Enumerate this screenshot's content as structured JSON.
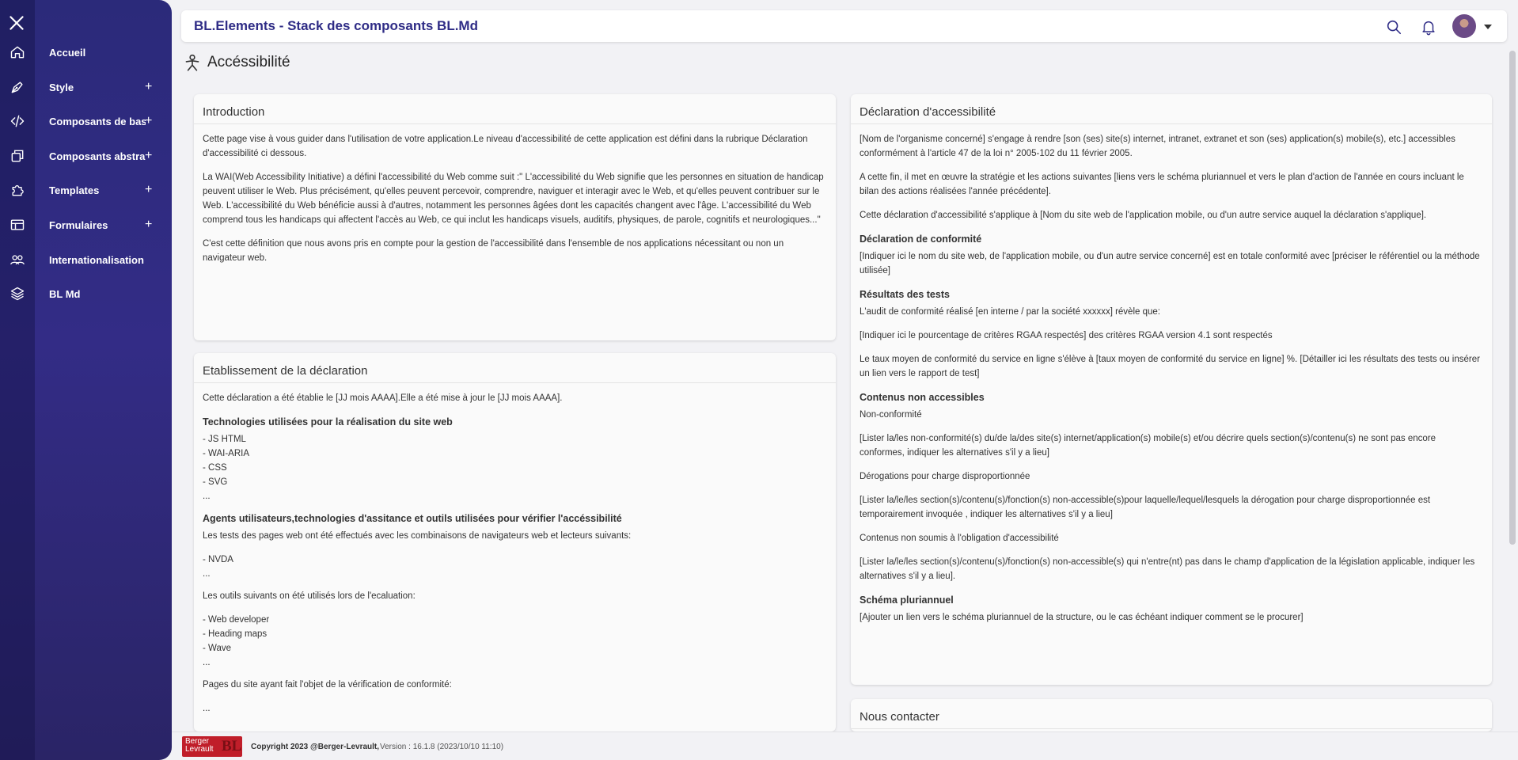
{
  "header": {
    "title": "BL.Elements - Stack des composants BL.Md",
    "icons": [
      "search-icon",
      "bell-icon",
      "avatar",
      "caret-down-icon"
    ]
  },
  "sidebar": {
    "items": [
      {
        "label": "Accueil",
        "icon": "home-icon",
        "expandable": false
      },
      {
        "label": "Style",
        "icon": "pen-icon",
        "expandable": true
      },
      {
        "label": "Composants de base",
        "icon": "code-icon",
        "expandable": true
      },
      {
        "label": "Composants abstraits",
        "icon": "copy-icon",
        "expandable": true
      },
      {
        "label": "Templates",
        "icon": "puzzle-icon",
        "expandable": true
      },
      {
        "label": "Formulaires",
        "icon": "form-icon",
        "expandable": true
      },
      {
        "label": "Internationalisation",
        "icon": "people-icon",
        "expandable": false
      },
      {
        "label": "BL Md",
        "icon": "layers-icon",
        "expandable": false
      }
    ],
    "plus": "+"
  },
  "page": {
    "title": "Accéssibilité"
  },
  "intro": {
    "title": "Introduction",
    "p1": "Cette page vise à vous guider dans l'utilisation de votre application.Le niveau d'accessibilité de cette application est défini dans la rubrique Déclaration d'accessibilité ci dessous.",
    "p2": "La WAI(Web Accessibility Initiative) a défini l'accessibilité du Web comme suit :\" L'accessibilité du Web signifie que les personnes en situation de handicap peuvent utiliser le Web. Plus précisément, qu'elles peuvent percevoir, comprendre, naviguer et interagir avec le Web, et qu'elles peuvent contribuer sur le Web. L'accessibilité du Web bénéficie aussi à d'autres, notamment les personnes âgées dont les capacités changent avec l'âge. L'accessibilité du Web comprend tous les handicaps qui affectent l'accès au Web, ce qui inclut les handicaps visuels, auditifs, physiques, de parole, cognitifs et neurologiques...\"",
    "p3": "C'est cette définition que nous avons pris en compte pour la gestion de l'accessibilité dans l'ensemble de nos applications nécessitant ou non un navigateur web."
  },
  "etab": {
    "title": "Etablissement de la déclaration",
    "p1": "Cette déclaration a été établie le [JJ mois AAAA].Elle a été mise à jour le [JJ mois AAAA].",
    "h1": "Technologies utilisées pour la réalisation du site web",
    "tech": [
      "- JS HTML",
      "- WAI-ARIA",
      "- CSS",
      "- SVG",
      "..."
    ],
    "h2": "Agents utilisateurs,technologies d'assitance et outils utilisées pour vérifier l'accéssibilité",
    "p2": "Les tests des pages web ont été effectués avec les combinaisons de navigateurs web et lecteurs suivants:",
    "readers": [
      "- NVDA",
      "..."
    ],
    "p3": "Les outils suivants on été utilisés lors de l'ecaluation:",
    "tools": [
      "- Web developer",
      "- Heading maps",
      "- Wave",
      "..."
    ],
    "p4": "Pages du site ayant fait l'objet de la vérification de conformité:",
    "pages": [
      "..."
    ]
  },
  "decl": {
    "title": "Déclaration d'accessibilité",
    "p1": "[Nom de l'organisme concerné] s'engage à rendre [son (ses) site(s) internet, intranet, extranet et son (ses) application(s) mobile(s), etc.] accessibles conformément à l'article 47 de la loi n° 2005-102 du 11 février 2005.",
    "p2": "A cette fin, il met en œuvre la stratégie et les actions suivantes [liens vers le schéma pluriannuel et vers le plan d'action de l'année en cours incluant le bilan des actions réalisées l'année précédente].",
    "p3": "Cette déclaration d'accessibilité s'applique à [Nom du site web de l'application mobile, ou d'un autre service auquel la déclaration s'applique].",
    "h1": "Déclaration de conformité",
    "p4": "[Indiquer ici le nom du site web, de l'application mobile, ou d'un autre service concerné] est en totale conformité avec [préciser le référentiel ou la méthode utilisée]",
    "h2": "Résultats des tests",
    "p5": "L'audit de conformité réalisé [en interne / par la société xxxxxx] révèle que:",
    "p6": "[Indiquer ici le pourcentage de critères RGAA respectés] des critères RGAA version 4.1 sont respectés",
    "p7": "Le taux moyen de conformité du service en ligne s'élève à [taux moyen de conformité du service en ligne] %. [Détailler ici les résultats des tests ou insérer un lien vers le rapport de test]",
    "h3": "Contenus non accessibles",
    "p8": "Non-conformité",
    "p9": "[Lister la/les non-conformité(s) du/de la/des site(s) internet/application(s) mobile(s) et/ou décrire quels section(s)/contenu(s) ne sont pas encore conformes, indiquer les alternatives s'il y a lieu]",
    "p10": "Dérogations pour charge disproportionnée",
    "p11": "[Lister la/le/les section(s)/contenu(s)/fonction(s) non-accessible(s)pour laquelle/lequel/lesquels la dérogation pour charge disproportionnée est temporairement invoquée , indiquer les alternatives s'il y a lieu]",
    "p12": "Contenus non soumis à l'obligation d'accessibilité",
    "p13": "[Lister la/le/les section(s)/contenu(s)/fonction(s) non-accessible(s) qui n'entre(nt) pas dans le champ d'application de la législation applicable, indiquer les alternatives s'il y a lieu].",
    "h4": "Schéma pluriannuel",
    "p14": "[Ajouter un lien vers le schéma pluriannuel de la structure, ou le cas échéant indiquer comment se le procurer]"
  },
  "contact": {
    "title": "Nous contacter"
  },
  "footer": {
    "logo_line1": "Berger",
    "logo_line2": "Levrault",
    "logo_mark": "BL",
    "copyright": "Copyright 2023 @Berger-Levrault,",
    "version": "Version : 16.1.8 (2023/10/10 11:10)"
  },
  "colors": {
    "sidebar": "#2b2a7a",
    "accent": "#2f2c86",
    "background": "#f2f2f5",
    "logo": "#c01e2a"
  }
}
